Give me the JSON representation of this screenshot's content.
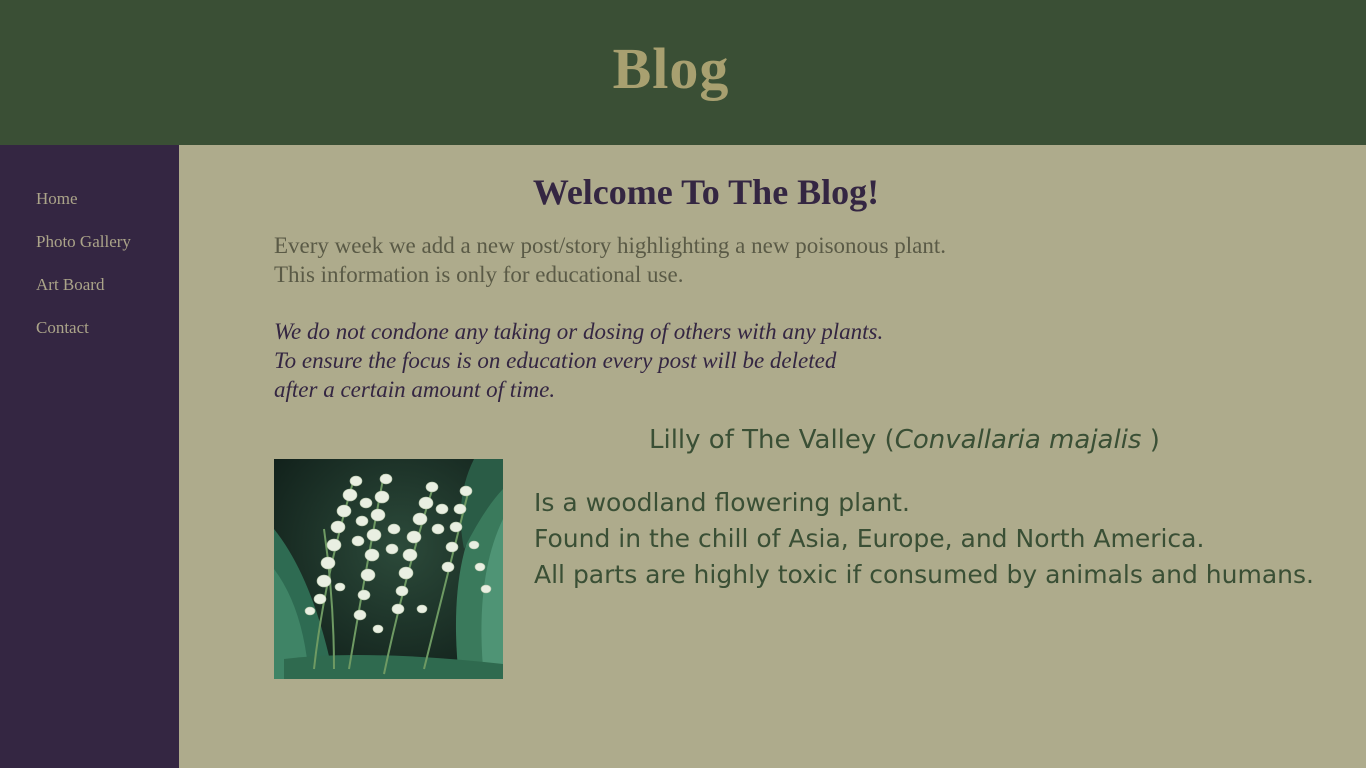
{
  "header": {
    "title": "Blog"
  },
  "sidebar": {
    "items": [
      {
        "label": "Home"
      },
      {
        "label": "Photo Gallery"
      },
      {
        "label": "Art Board"
      },
      {
        "label": "Contact"
      }
    ]
  },
  "main": {
    "heading": "Welcome To The Blog!",
    "intro": {
      "line1": "Every week we add a new post/story highlighting a new poisonous plant.",
      "line2": "This information is only for educational use."
    },
    "disclaimer": {
      "line1": "We do not condone any taking or dosing of others with any plants.",
      "line2": "To ensure the focus is on education every post will be deleted",
      "line3": "after a certain amount of time."
    },
    "post": {
      "common_name": "Lilly of The Valley (",
      "scientific_name": "Convallaria majalis",
      "closing": " )",
      "body": {
        "line1": "Is a woodland flowering plant.",
        "line2": "Found in the chill of Asia, Europe, and North America.",
        "line3": "All parts are highly toxic if consumed by animals and humans."
      }
    }
  },
  "colors": {
    "header_bg": "#3a4f35",
    "sidebar_bg": "#342642",
    "content_bg": "#aeab8c",
    "title_color": "#a8a070",
    "accent_dark": "#342642"
  }
}
